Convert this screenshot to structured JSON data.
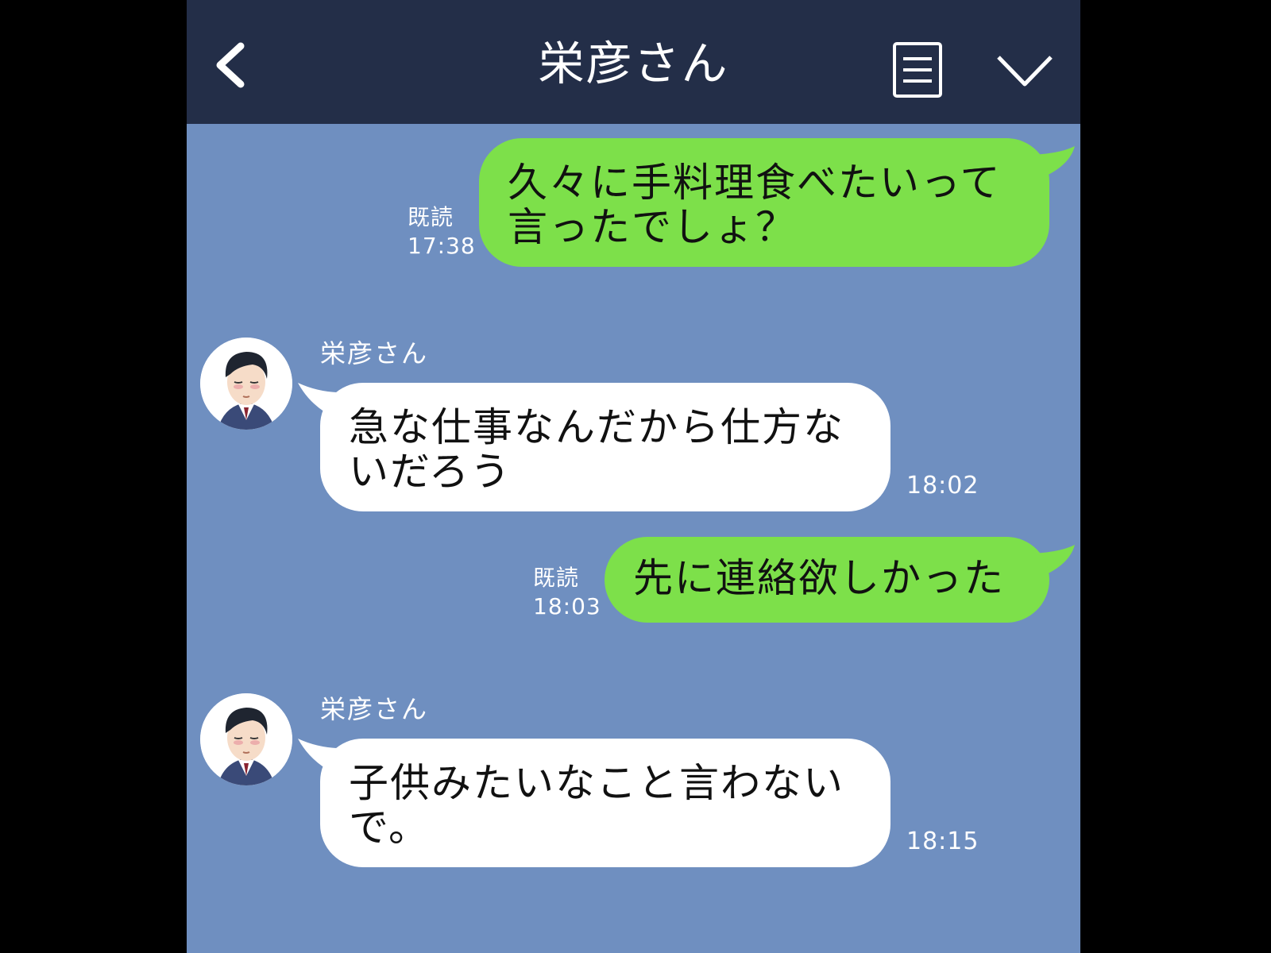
{
  "header": {
    "title": "栄彦さん"
  },
  "messages": [
    {
      "side": "outgoing",
      "text": "久々に手料理食べたいって\n言ったでしょ？",
      "read_label": "既読",
      "time": "17:38"
    },
    {
      "side": "incoming",
      "sender": "栄彦さん",
      "text": "急な仕事なんだから仕方な\nいだろう",
      "time": "18:02"
    },
    {
      "side": "outgoing",
      "text": "先に連絡欲しかった",
      "read_label": "既読",
      "time": "18:03"
    },
    {
      "side": "incoming",
      "sender": "栄彦さん",
      "text": "子供みたいなこと言わない\nで。",
      "time": "18:15"
    }
  ],
  "colors": {
    "background": "#6f8fc0",
    "header": "#232e48",
    "outgoing_bubble": "#7de04a",
    "incoming_bubble": "#ffffff"
  },
  "icons": {
    "back": "back-chevron-icon",
    "menu": "menu-list-icon",
    "collapse": "chevron-down-icon",
    "avatar": "avatar-man-suit"
  }
}
